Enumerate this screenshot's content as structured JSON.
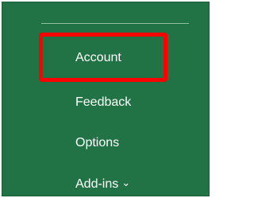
{
  "menu": {
    "items": [
      {
        "label": "Account"
      },
      {
        "label": "Feedback"
      },
      {
        "label": "Options"
      },
      {
        "label": "Add-ins",
        "has_dropdown": true,
        "dropdown_glyph": "⌄"
      }
    ]
  },
  "highlight": {
    "target": "Account",
    "color": "#ff0000"
  },
  "colors": {
    "panel_background": "#217346",
    "text": "#ffffff",
    "separator": "#8fbfa3"
  }
}
